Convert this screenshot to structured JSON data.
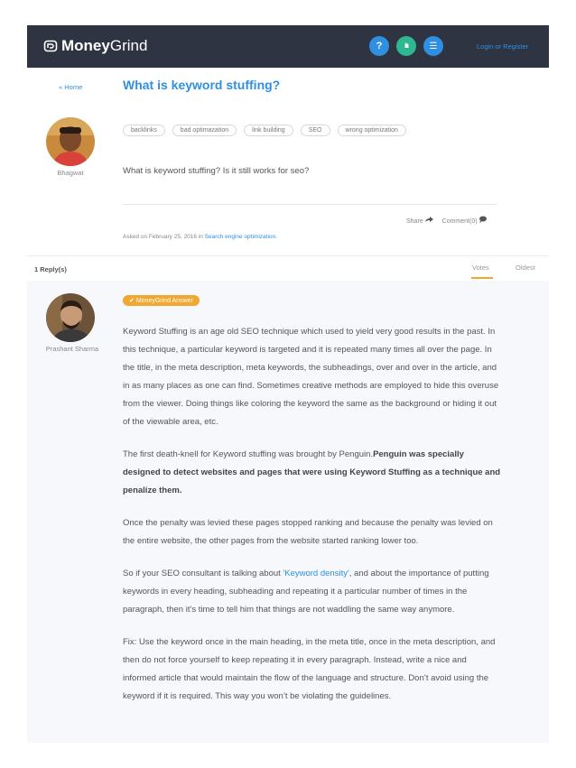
{
  "header": {
    "brand_bold": "Money",
    "brand_light": "Grind",
    "icons": [
      "help-icon",
      "stats-icon",
      "list-icon"
    ],
    "help_glyph": "?",
    "stats_glyph": "lılı",
    "list_glyph": "☰",
    "login": "Login or Register",
    "colors": {
      "bar": "#2e3442",
      "blue": "#2f8fe0",
      "green": "#2eb891",
      "orange": "#f0a830"
    }
  },
  "titlebar": {
    "home": "« Home",
    "title": "What is keyword stuffing?"
  },
  "question": {
    "author": "Bhagwat",
    "tags": [
      "backlinks",
      "bad optimazation",
      "link building",
      "SEO",
      "wrong optimization"
    ],
    "text": "What is keyword stuffing? Is it still works for seo?",
    "share": "Share",
    "comment": "Comment(0)",
    "asked_prefix": "Asked on February 25, 2016 in",
    "category": "Search engine optimization."
  },
  "replies": {
    "count": "1 Reply(s)",
    "votes": "Votes",
    "oldest": "Oldest"
  },
  "answer": {
    "author": "Prashant Sharma",
    "badge": "MoneyGrind Answer",
    "p1": "Keyword Stuffing is an age old SEO technique which used to yield very good results in the past. In this technique, a particular keyword is targeted and it is repeated many times all over the page. In the title, in the meta description, meta keywords, the subheadings, over and over in the article, and in as many places as one can find. Sometimes creative methods are employed to hide this overuse from the viewer. Doing things like coloring the keyword the same as the background or hiding it out of the viewable area, etc.",
    "p2_a": "The first death-knell for Keyword stuffing was brought by Penguin.",
    "p2_b": "Penguin was specially designed to detect websites and pages that were using Keyword Stuffing as a technique and penalize them.",
    "p3": "Once the penalty was levied these pages stopped ranking and because the penalty was levied on the entire website, the other pages from the website started ranking lower too.",
    "p4_a": "So if your SEO consultant is talking about ",
    "p4_link": "'Keyword density'",
    "p4_b": ", and about the importance of putting keywords in every heading, subheading and repeating it a particular number of times in the paragraph, then it’s time to tell him that things are not waddling the same way anymore.",
    "p5": "Fix: Use the keyword once in the main heading, in the meta title, once in the meta description, and then do not force yourself to keep repeating it in every paragraph. Instead, write a nice and informed article that would maintain the flow of the language and structure. Don’t avoid using the keyword if it is required. This way you won’t be violating the guidelines."
  }
}
